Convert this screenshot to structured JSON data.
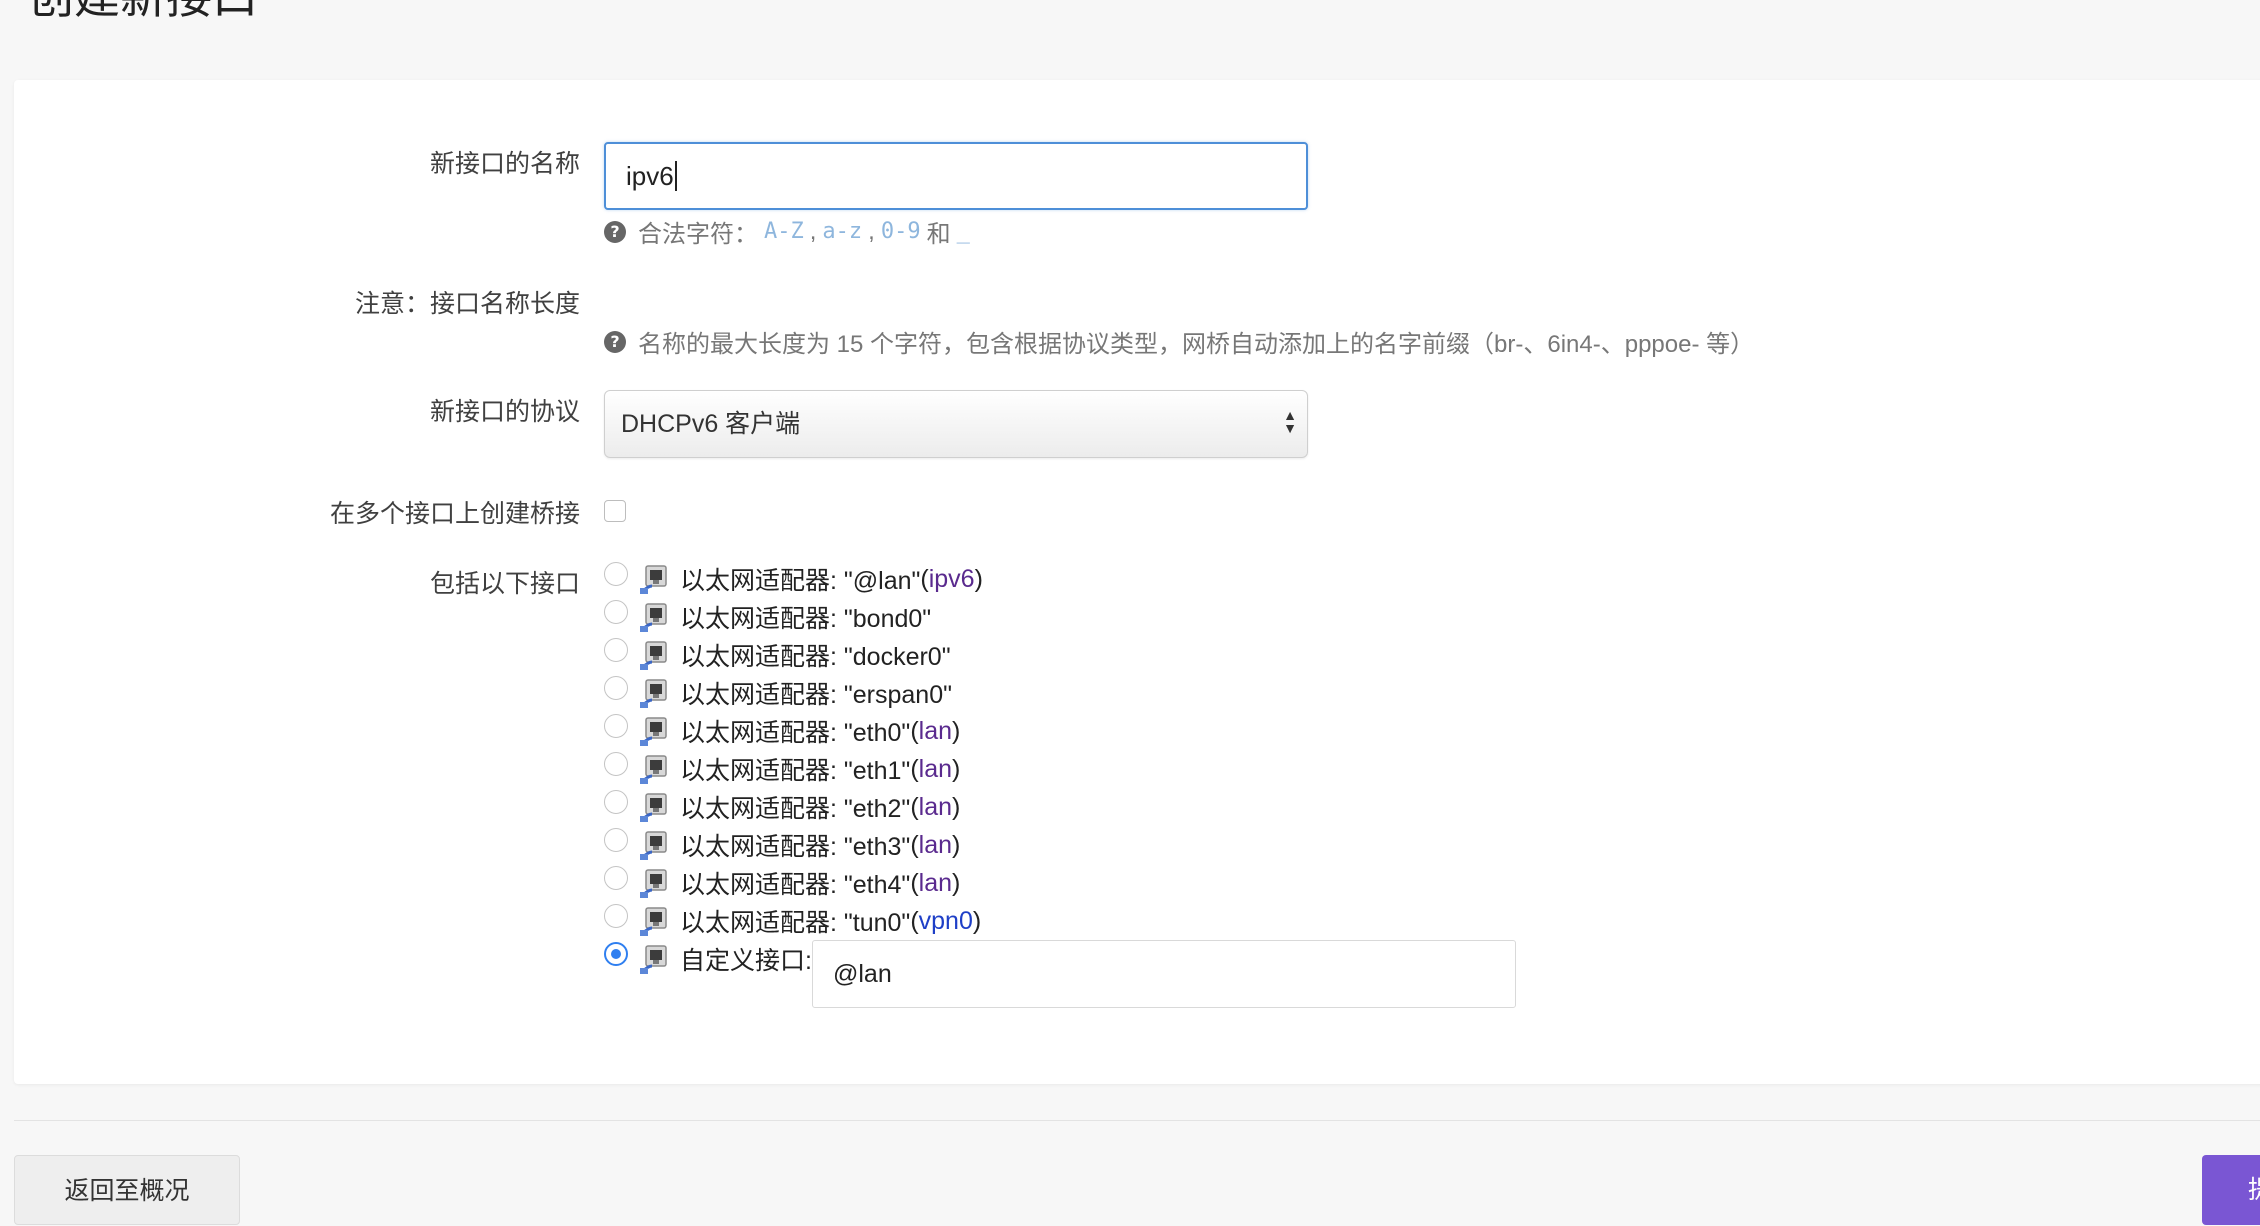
{
  "page": {
    "title": "创建新接口"
  },
  "form": {
    "name": {
      "label": "新接口的名称",
      "value": "ipv6",
      "help_prefix": "合法字符：",
      "chars_az_upper": "A-Z",
      "chars_az_lower": "a-z",
      "chars_digits": "0-9",
      "chars_and": "和",
      "chars_underscore": "_",
      "comma": ","
    },
    "note": {
      "label": "注意：接口名称长度",
      "help": "名称的最大长度为 15 个字符，包含根据协议类型，网桥自动添加上的名字前缀（br-、6in4-、pppoe- 等）"
    },
    "protocol": {
      "label": "新接口的协议",
      "selected": "DHCPv6 客户端"
    },
    "bridge": {
      "label": "在多个接口上创建桥接",
      "checked": false
    },
    "interfaces": {
      "label": "包括以下接口",
      "items": [
        {
          "text": "以太网适配器: \"@lan\"",
          "open": " (",
          "network": "ipv6",
          "close": ")",
          "checked": false,
          "network_color": "#5a2a8e"
        },
        {
          "text": "以太网适配器: \"bond0\"",
          "open": "",
          "network": "",
          "close": "",
          "checked": false
        },
        {
          "text": "以太网适配器: \"docker0\"",
          "open": "",
          "network": "",
          "close": "",
          "checked": false
        },
        {
          "text": "以太网适配器: \"erspan0\"",
          "open": "",
          "network": "",
          "close": "",
          "checked": false
        },
        {
          "text": "以太网适配器: \"eth0\"",
          "open": " (",
          "network": "lan",
          "close": ")",
          "checked": false
        },
        {
          "text": "以太网适配器: \"eth1\"",
          "open": " (",
          "network": "lan",
          "close": ")",
          "checked": false
        },
        {
          "text": "以太网适配器: \"eth2\"",
          "open": " (",
          "network": "lan",
          "close": ")",
          "checked": false
        },
        {
          "text": "以太网适配器: \"eth3\"",
          "open": " (",
          "network": "lan",
          "close": ")",
          "checked": false
        },
        {
          "text": "以太网适配器: \"eth4\"",
          "open": " (",
          "network": "lan",
          "close": ")",
          "checked": false
        },
        {
          "text": "以太网适配器: \"tun0\"",
          "open": " (",
          "network": "vpn0",
          "close": ")",
          "checked": false,
          "network_color": "#1e3fc7"
        }
      ],
      "custom": {
        "label": "自定义接口:",
        "value": "@lan",
        "checked": true
      }
    }
  },
  "footer": {
    "back_label": "返回至概况",
    "submit_label": "提交"
  }
}
